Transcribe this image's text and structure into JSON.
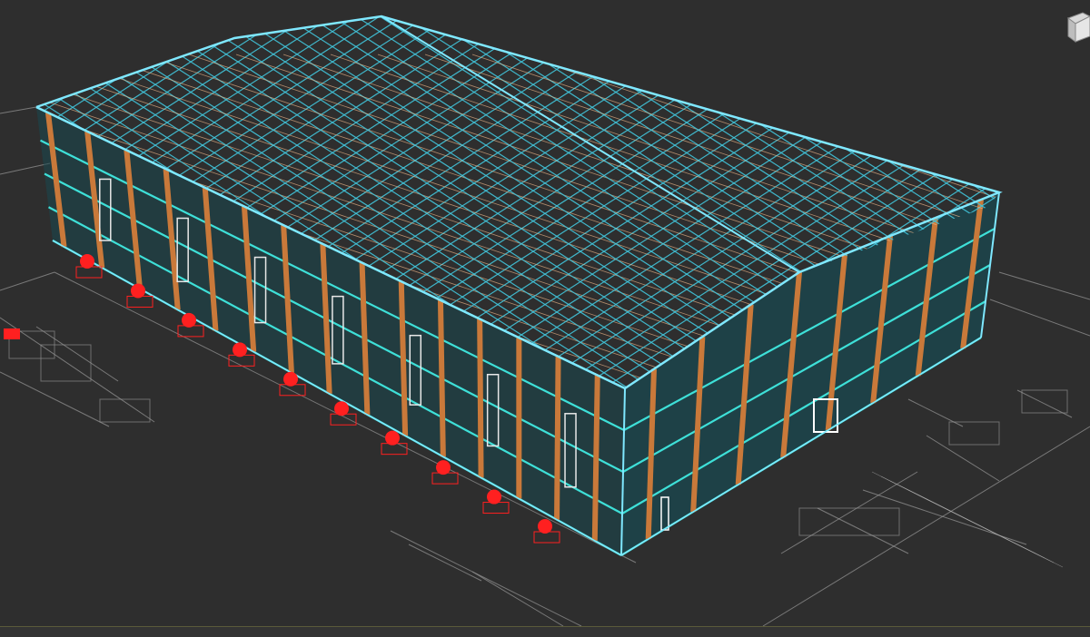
{
  "viewport": {
    "background_color": "#2e2e2e",
    "frame_color": "#7fe8ff",
    "roof_truss_color": "#42c6dc",
    "roof_secondary_color": "#f0b88a",
    "column_color": "#c9793a",
    "wall_rail_color": "#3ee0d8",
    "wall_panel_color": "#1a4850",
    "foundation_marker_color": "#ff2020",
    "cad_linework_color": "#9a9a9a",
    "viewcube_icon": "viewcube-icon"
  },
  "scene": {
    "columns_long_side": 15,
    "columns_front_gable": 8,
    "wall_rail_rows": 4,
    "foundation_markers": 10
  }
}
